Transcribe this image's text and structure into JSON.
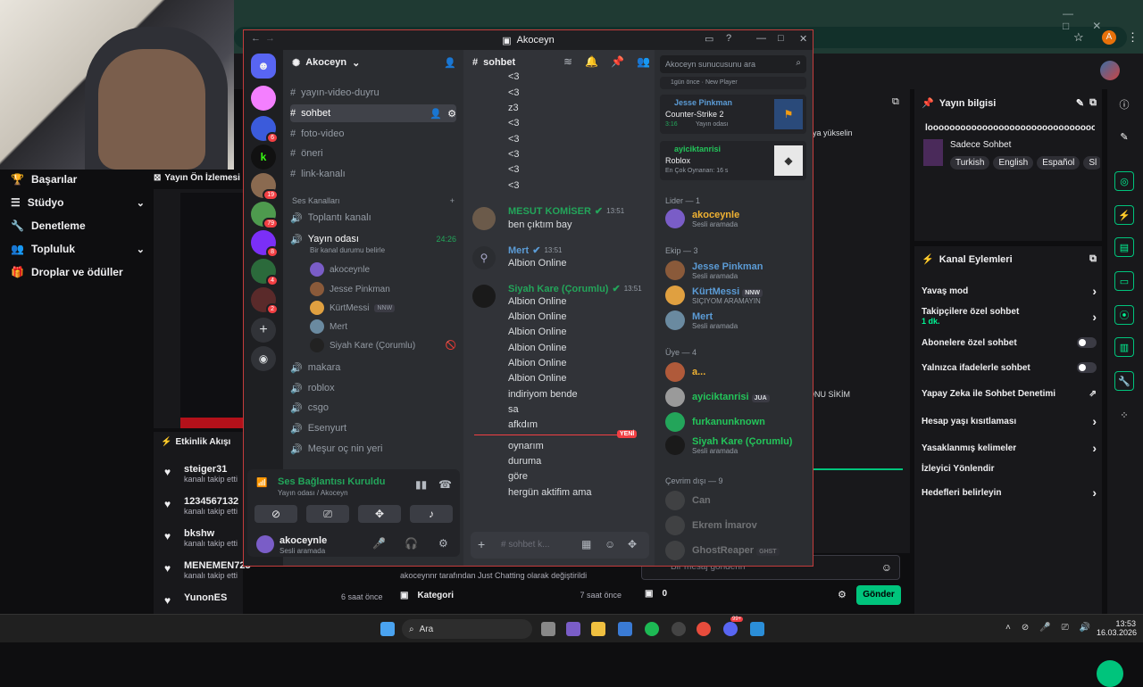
{
  "browser": {
    "avatar_letter": "A"
  },
  "twitch_nav": {
    "items": [
      {
        "label": "Başarılar"
      },
      {
        "label": "Stüdyo"
      },
      {
        "label": "Denetleme"
      },
      {
        "label": "Topluluk"
      },
      {
        "label": "Droplar ve ödüller"
      }
    ],
    "preview_title": "Yayın Ön İzlemesi"
  },
  "activity": {
    "title": "Etkinlik Akışı",
    "rows": [
      {
        "name": "steiger31",
        "sub": "kanalı takip etti"
      },
      {
        "name": "1234567132",
        "sub": "kanalı takip etti"
      },
      {
        "name": "bkshw",
        "sub": "kanalı takip etti"
      },
      {
        "name": "MENEMEN725",
        "sub": "kanalı takip etti"
      },
      {
        "name": "YunonES",
        "sub": "",
        "time": "6 saat önce"
      }
    ],
    "change_text": "akoceynnr tarafından Just Chatting olarak değiştirildi",
    "kategori": "Kategori",
    "kategori_time": "7 saat önce"
  },
  "stream_info": {
    "title": "Yayın bilgisi",
    "stream_title": "looooooooooooooooooooooooooooooolllll",
    "category": "Sadece Sohbet",
    "tags": [
      "Turkish",
      "English",
      "Español",
      "Sl"
    ],
    "promo": "aya yükselin"
  },
  "channel_actions": {
    "title": "Kanal Eylemleri",
    "items": [
      {
        "label": "Yavaş mod",
        "ctrl": "chevron"
      },
      {
        "label": "Takipçilere özel sohbet",
        "sub": "1 dk.",
        "ctrl": "chevron"
      },
      {
        "label": "Abonelere özel sohbet",
        "ctrl": "toggle"
      },
      {
        "label": "Yalnızca ifadelerle sohbet",
        "ctrl": "toggle"
      },
      {
        "label": "Yapay Zeka ile Sohbet Denetimi",
        "ctrl": "external"
      },
      {
        "label": "Hesap yaşı kısıtlaması",
        "ctrl": "chevron"
      },
      {
        "label": "Yasaklanmış kelimeler",
        "ctrl": "chevron"
      },
      {
        "label": "İzleyici Yönlendir",
        "ctrl": "none"
      },
      {
        "label": "Hedefleri belirleyin",
        "ctrl": "chevron"
      }
    ]
  },
  "twitch_chat": {
    "placeholder": "Bir mesaj gönderin",
    "points": "0",
    "send": "Gönder",
    "snippet": "ONU SİKİM"
  },
  "discord": {
    "window_title": "Akoceyn",
    "server_name": "Akoceyn",
    "server_badges": [
      "6",
      "19",
      "79",
      "8",
      "4",
      "2"
    ],
    "channels": [
      {
        "name": "yayın-video-duyru",
        "icon": "#"
      },
      {
        "name": "sohbet",
        "icon": "#",
        "active": true
      },
      {
        "name": "foto-video",
        "icon": "#"
      },
      {
        "name": "öneri",
        "icon": "#"
      },
      {
        "name": "link-kanalı",
        "icon": "#"
      }
    ],
    "voice_header": "Ses Kanalları",
    "voice_channels": [
      {
        "name": "Toplantı kanalı"
      },
      {
        "name": "Yayın odası",
        "time": "24:26",
        "sub": "Bir kanal durumu belirle"
      }
    ],
    "voice_users": [
      {
        "name": "akoceynle",
        "color": "#dbdee1"
      },
      {
        "name": "Jesse Pinkman",
        "color": "#dbdee1"
      },
      {
        "name": "KürtMessi",
        "tag": "NNW",
        "color": "#dbdee1"
      },
      {
        "name": "Mert",
        "color": "#dbdee1"
      },
      {
        "name": "Siyah Kare (Çorumlu)",
        "color": "#dbdee1"
      }
    ],
    "more_voice": [
      "makara",
      "roblox",
      "csgo",
      "Esenyurt",
      "Meşur oç nin yeri"
    ],
    "voice_status": {
      "title": "Ses Bağlantısı Kuruldu",
      "sub": "Yayın odası / Akoceyn"
    },
    "self_user": {
      "name": "akoceynle",
      "status": "Sesli aramada"
    },
    "chat_header": {
      "channel": "sohbet",
      "search_placeholder": "Akoceyn sunucusunu ara"
    },
    "lines_top": [
      "<3",
      "<3",
      "z3",
      "<3",
      "<3",
      "<3",
      "<3",
      "<3"
    ],
    "messages": [
      {
        "author": "MESUT KOMİSER",
        "time": "13:51",
        "color": "#23a55a",
        "lines": [
          "ben çıktım bay"
        ]
      },
      {
        "author": "Mert",
        "time": "13:51",
        "color": "#5865f2",
        "lines": [
          "Albion Online"
        ]
      },
      {
        "author": "Siyah Kare (Çorumlu)",
        "time": "13:51",
        "color": "#23a55a",
        "lines": [
          "Albion Online",
          "Albion Online",
          "Albion Online",
          "Albion Online",
          "Albion Online",
          "Albion Online",
          "indiriyom bende",
          "sa",
          "afkdım"
        ]
      }
    ],
    "new_label": "YENİ",
    "after_new": [
      "oynarım",
      "duruma",
      "göre",
      "hergün aktifim ama"
    ],
    "composer_placeholder": "sohbet k...",
    "activity_cards": [
      {
        "top": "1gün önce",
        "top2": "New Player"
      },
      {
        "name": "Jesse Pinkman",
        "game": "Counter-Strike 2",
        "detail": "3:16",
        "detail2": "Yayın odası"
      },
      {
        "name": "ayiciktanrisi",
        "game": "Roblox",
        "detail": "En Çok Oynanan: 16 s"
      }
    ],
    "groups": [
      {
        "label": "Lider — 1",
        "members": [
          {
            "name": "akoceynle",
            "status": "Sesli aramada",
            "color": "#f0b232"
          }
        ]
      },
      {
        "label": "Ekip — 3",
        "members": [
          {
            "name": "Jesse Pinkman",
            "status": "Sesli aramada",
            "color": "#5b9bd5"
          },
          {
            "name": "KürtMessi",
            "tag": "NNW",
            "status": "SIÇIYOM ARAMAYIN",
            "color": "#5b9bd5"
          },
          {
            "name": "Mert",
            "status": "Sesli aramada",
            "color": "#5b9bd5"
          }
        ]
      },
      {
        "label": "Üye — 4",
        "members": [
          {
            "name": "a...",
            "status": "",
            "color": "#f0b232"
          },
          {
            "name": "ayiciktanrisi",
            "tag": "JUA",
            "status": "",
            "color": "#23c55a"
          },
          {
            "name": "furkanunknown",
            "status": "",
            "color": "#23c55a"
          },
          {
            "name": "Siyah Kare (Çorumlu)",
            "status": "Sesli aramada",
            "color": "#23c55a"
          }
        ]
      },
      {
        "label": "Çevrim dışı — 9",
        "members": [
          {
            "name": "Can",
            "status": "",
            "color": "#4e5058"
          },
          {
            "name": "Ekrem İmarov",
            "status": "",
            "color": "#4e5058"
          },
          {
            "name": "GhostReaper",
            "tag": "GHST",
            "status": "",
            "color": "#4e5058"
          }
        ]
      }
    ]
  },
  "taskbar": {
    "search": "Ara",
    "time": "13:53",
    "date": "16.03.2026",
    "badge": "99+"
  }
}
